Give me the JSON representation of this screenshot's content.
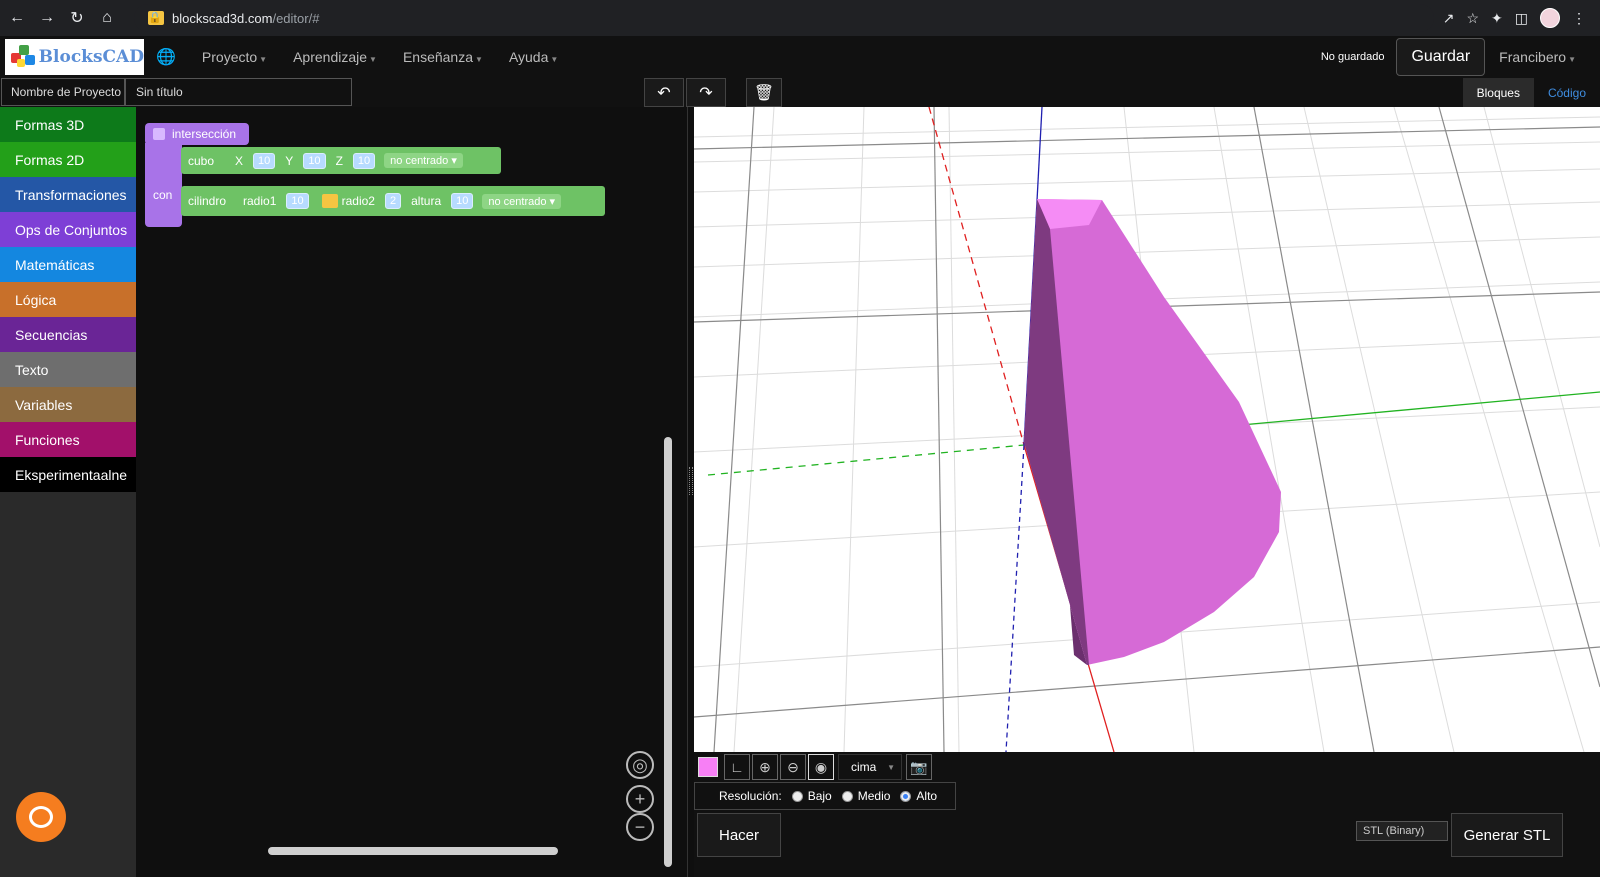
{
  "browser": {
    "url_host": "blockscad3d.com",
    "url_path": "/editor/#"
  },
  "navbar": {
    "logo_text": "BlocksCAD",
    "menu": [
      {
        "label": "Proyecto"
      },
      {
        "label": "Aprendizaje"
      },
      {
        "label": "Enseñanza"
      },
      {
        "label": "Ayuda"
      }
    ],
    "status": "No guardado",
    "save_label": "Guardar",
    "user": "Francibero"
  },
  "project": {
    "name_label": "Nombre de Proyecto",
    "name_value": "Sin título"
  },
  "view_tabs": {
    "blocks": "Bloques",
    "code": "Código"
  },
  "categories": [
    {
      "label": "Formas 3D",
      "color": "#0d7a1a"
    },
    {
      "label": "Formas 2D",
      "color": "#23a019"
    },
    {
      "label": "Transformaciones",
      "color": "#2457a6"
    },
    {
      "label": "Ops de Conjuntos",
      "color": "#7e3fd6"
    },
    {
      "label": "Matemáticas",
      "color": "#1487e0"
    },
    {
      "label": "Lógica",
      "color": "#c8702a"
    },
    {
      "label": "Secuencias",
      "color": "#6a2596"
    },
    {
      "label": "Texto",
      "color": "#6e6e6e"
    },
    {
      "label": "Variables",
      "color": "#8c6a3f"
    },
    {
      "label": "Funciones",
      "color": "#a2106a"
    },
    {
      "label": "Eksperimentaalne",
      "color": "#000000"
    }
  ],
  "blocks": {
    "intersection_label": "intersección",
    "with_label": "con",
    "cube": {
      "label": "cubo",
      "x_label": "X",
      "x": "10",
      "y_label": "Y",
      "y": "10",
      "z_label": "Z",
      "z": "10",
      "centered": "no centrado"
    },
    "cylinder": {
      "label": "cilindro",
      "r1_label": "radio1",
      "r1": "10",
      "r2_label": "radio2",
      "r2": "2",
      "h_label": "altura",
      "h": "10",
      "centered": "no centrado"
    }
  },
  "viewer": {
    "object_color": "#f77ff5",
    "view": "cima",
    "resolution_label": "Resolución:",
    "resolutions": [
      "Bajo",
      "Medio",
      "Alto"
    ],
    "selected_resolution": "Alto",
    "render_button": "Hacer",
    "export_format": "STL (Binary)",
    "export_button": "Generar STL"
  }
}
